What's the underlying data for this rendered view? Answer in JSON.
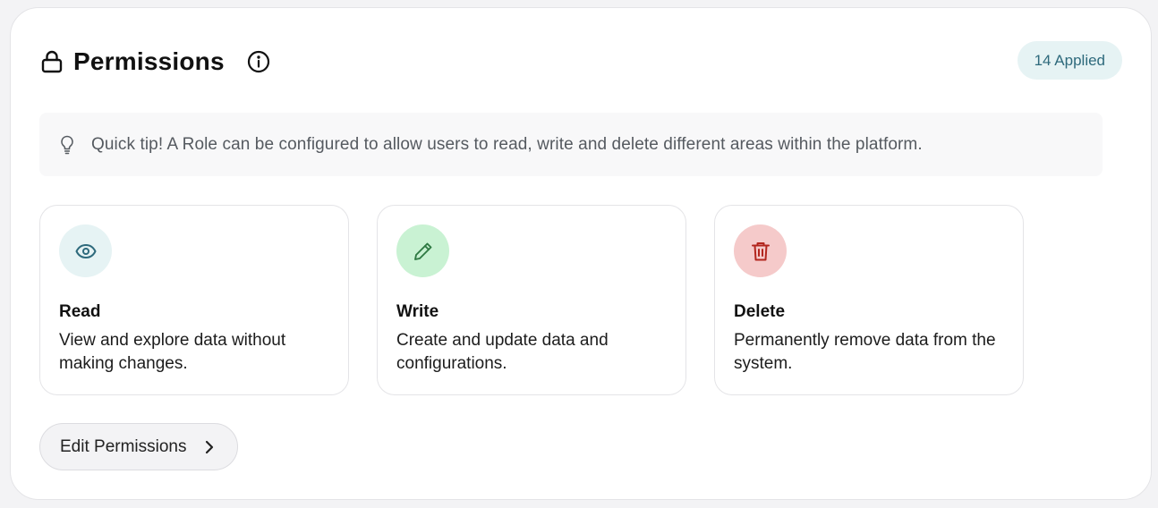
{
  "header": {
    "title": "Permissions",
    "badge": "14 Applied",
    "icons": [
      "lock-icon",
      "info-icon"
    ]
  },
  "tip": {
    "icon": "lightbulb-icon",
    "text": "Quick tip! A Role can be configured to allow users to read, write and delete different areas within the platform."
  },
  "cards": [
    {
      "icon": "eye-icon",
      "title": "Read",
      "description": "View and explore data without making changes.",
      "icon_bg": "#e6f3f4",
      "icon_color": "#2e6a7c"
    },
    {
      "icon": "pencil-icon",
      "title": "Write",
      "description": "Create and update data and configurations.",
      "icon_bg": "#c9f2d3",
      "icon_color": "#2f7a43"
    },
    {
      "icon": "trash-icon",
      "title": "Delete",
      "description": "Permanently remove data from the system.",
      "icon_bg": "#f5caca",
      "icon_color": "#b3261e"
    }
  ],
  "actions": {
    "edit_label": "Edit Permissions",
    "edit_icon": "chevron-right-icon"
  },
  "colors": {
    "badge_bg": "#e6f3f4",
    "badge_text": "#2e6a7c",
    "tip_bg": "#f8f8f9"
  }
}
